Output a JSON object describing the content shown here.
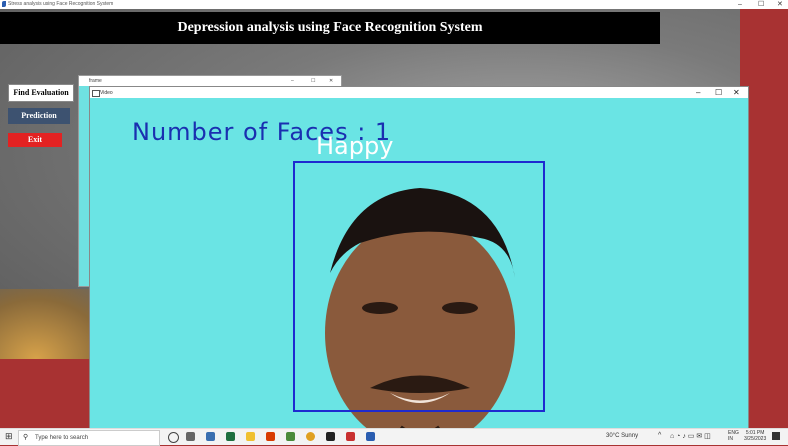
{
  "window": {
    "title": "Stress analysis using Face Recognition System",
    "controls": [
      "–",
      "☐",
      "✕"
    ]
  },
  "banner": {
    "title": "Depression analysis using Face Recognition System"
  },
  "side_buttons": {
    "find": "Find Evaluation",
    "predict": "Prediction",
    "exit": "Exit"
  },
  "frame_window": {
    "title": "frame",
    "controls": [
      "–",
      "☐",
      "✕"
    ]
  },
  "video_window": {
    "title": "Video",
    "controls": [
      "–",
      "☐",
      "✕"
    ],
    "overlay_count": "Number of Faces : 1",
    "overlay_emotion": "Happy"
  },
  "taskbar": {
    "search_placeholder": "Type here to search",
    "weather": "30°C  Sunny",
    "lang_top": "ENG",
    "lang_bottom": "IN",
    "time": "5:01 PM",
    "date": "3/25/2023"
  },
  "colors": {
    "banner_bg": "#000000",
    "predict_bg": "#3d5270",
    "exit_bg": "#e32222",
    "box": "#1e2ad0",
    "camera_bg": "#6ae4e4",
    "desktop": "#a83232"
  }
}
